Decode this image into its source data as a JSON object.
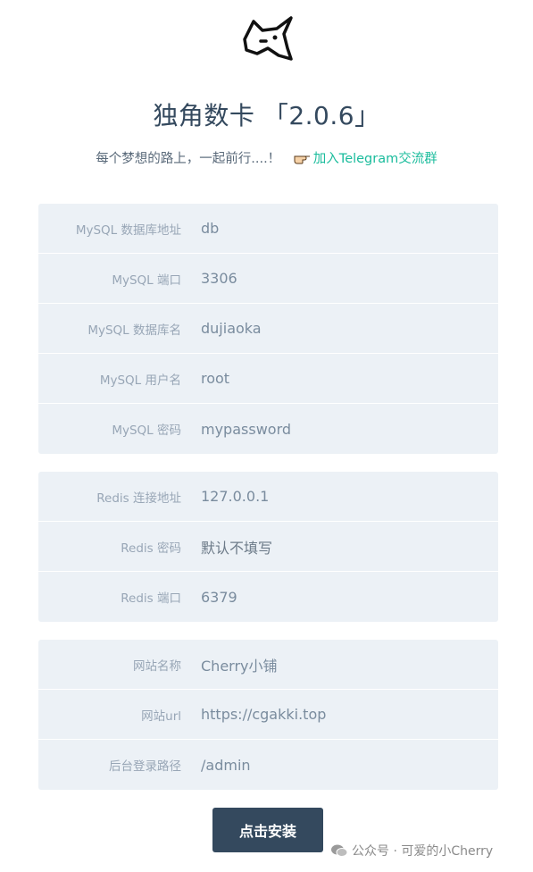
{
  "header": {
    "title": "独角数卡 「2.0.6」",
    "subtitle": "每个梦想的路上，一起前行....！",
    "telegram_link": "加入Telegram交流群"
  },
  "mysql": [
    {
      "label": "MySQL 数据库地址",
      "value": "db"
    },
    {
      "label": "MySQL 端口",
      "value": "3306"
    },
    {
      "label": "MySQL 数据库名",
      "value": "dujiaoka"
    },
    {
      "label": "MySQL 用户名",
      "value": "root"
    },
    {
      "label": "MySQL 密码",
      "value": "mypassword"
    }
  ],
  "redis": [
    {
      "label": "Redis 连接地址",
      "value": "127.0.0.1"
    },
    {
      "label": "Redis 密码",
      "value": "默认不填写"
    },
    {
      "label": "Redis 端口",
      "value": "6379"
    }
  ],
  "site": [
    {
      "label": "网站名称",
      "value": "Cherry小铺"
    },
    {
      "label": "网站url",
      "value": "https://cgakki.top"
    },
    {
      "label": "后台登录路径",
      "value": "/admin"
    }
  ],
  "install_button": "点击安装",
  "watermark": "公众号 · 可爱的小Cherry",
  "colors": {
    "accent": "#34495e",
    "link": "#1abc9c",
    "panel": "#ecf1f6"
  }
}
